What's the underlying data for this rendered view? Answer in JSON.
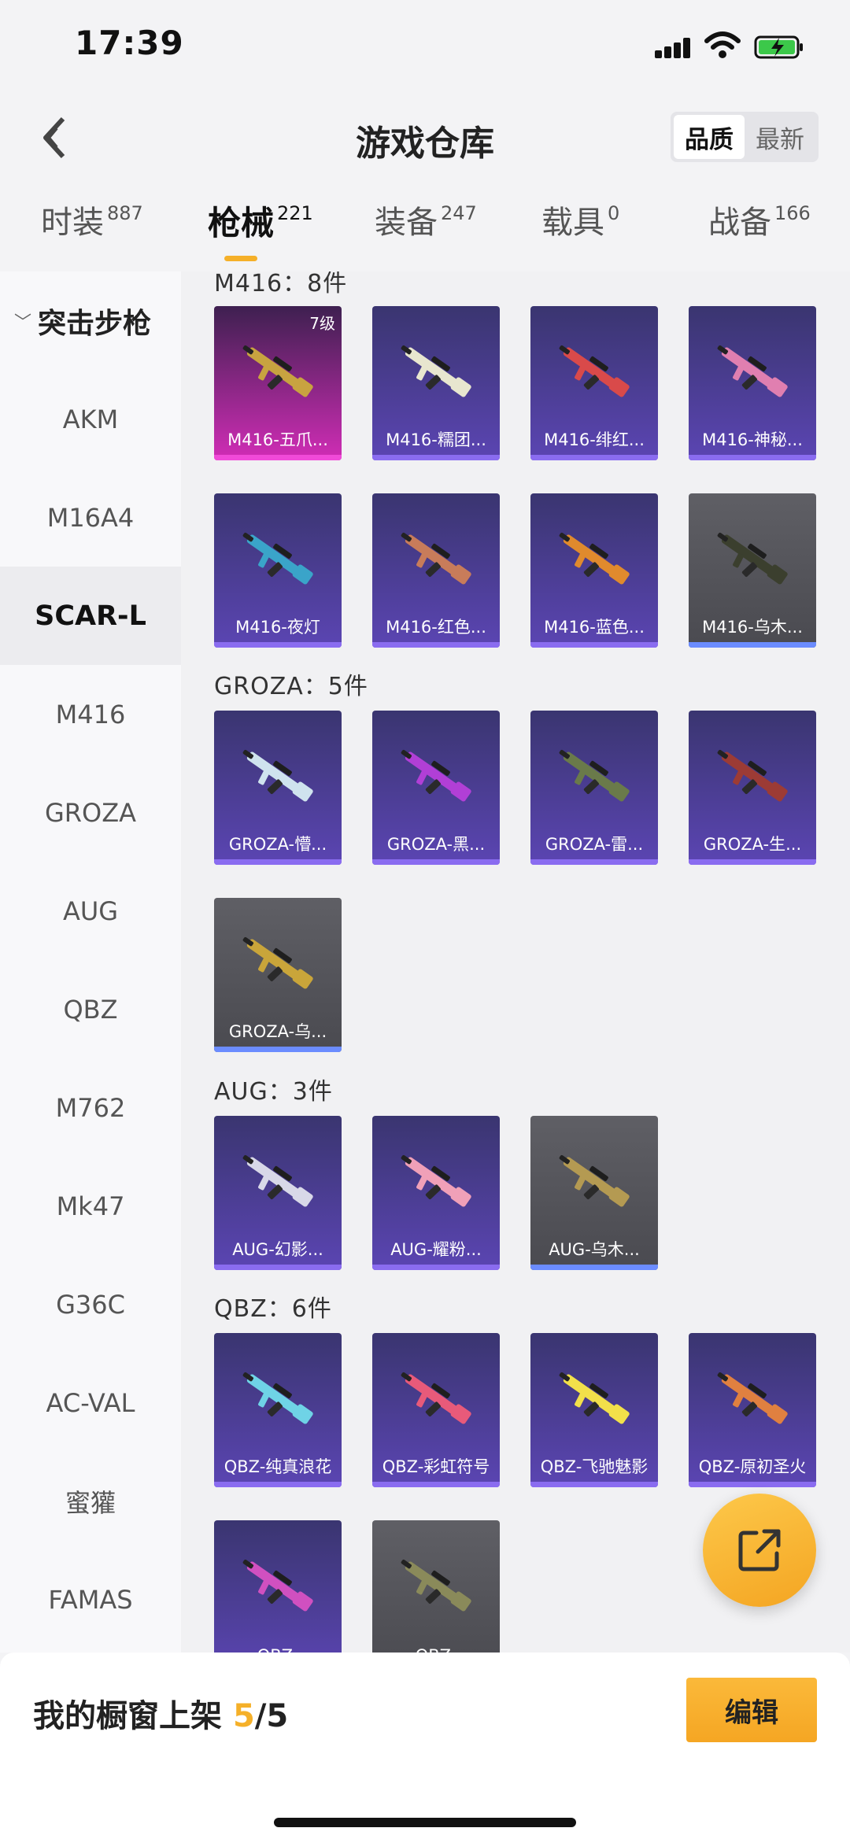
{
  "status": {
    "time": "17:39"
  },
  "header": {
    "title": "游戏仓库",
    "sort_options": [
      "品质",
      "最新"
    ]
  },
  "tabs": [
    {
      "label": "时装",
      "count": "887"
    },
    {
      "label": "枪械",
      "count": "221"
    },
    {
      "label": "装备",
      "count": "247"
    },
    {
      "label": "载具",
      "count": "0"
    },
    {
      "label": "战备",
      "count": "166"
    }
  ],
  "sidebar": {
    "group": "突击步枪",
    "items": [
      "AKM",
      "M16A4",
      "SCAR-L",
      "M416",
      "GROZA",
      "AUG",
      "QBZ",
      "M762",
      "Mk47",
      "G36C",
      "AC-VAL",
      "蜜獾",
      "FAMAS"
    ]
  },
  "sections": [
    {
      "title": "M416：8件",
      "items": [
        {
          "name": "M416-五爪...",
          "tier": "pink",
          "gun_color": "#c8a340",
          "level": "7级"
        },
        {
          "name": "M416-糯团...",
          "tier": "purple",
          "gun_color": "#e8e6cf"
        },
        {
          "name": "M416-绯红...",
          "tier": "purple",
          "gun_color": "#d94a4a"
        },
        {
          "name": "M416-神秘...",
          "tier": "purple",
          "gun_color": "#e07fb0"
        },
        {
          "name": "M416-夜灯",
          "tier": "purple",
          "gun_color": "#3aa4c9"
        },
        {
          "name": "M416-红色...",
          "tier": "purple",
          "gun_color": "#c87c5a"
        },
        {
          "name": "M416-蓝色...",
          "tier": "purple",
          "gun_color": "#e08a2d"
        },
        {
          "name": "M416-乌木...",
          "tier": "grey",
          "gun_color": "#3b3f2e"
        }
      ]
    },
    {
      "title": "GROZA：5件",
      "items": [
        {
          "name": "GROZA-懵...",
          "tier": "purple",
          "gun_color": "#cfe3ee"
        },
        {
          "name": "GROZA-黑...",
          "tier": "purple",
          "gun_color": "#b13fd6"
        },
        {
          "name": "GROZA-雷...",
          "tier": "purple",
          "gun_color": "#6a7a4a"
        },
        {
          "name": "GROZA-生...",
          "tier": "purple",
          "gun_color": "#9c3b35"
        },
        {
          "name": "GROZA-乌...",
          "tier": "grey",
          "gun_color": "#c9a53a"
        }
      ]
    },
    {
      "title": "AUG：3件",
      "items": [
        {
          "name": "AUG-幻影...",
          "tier": "purple",
          "gun_color": "#d8d8e8"
        },
        {
          "name": "AUG-耀粉...",
          "tier": "purple",
          "gun_color": "#f0a0b8"
        },
        {
          "name": "AUG-乌木...",
          "tier": "grey",
          "gun_color": "#b49a52"
        }
      ]
    },
    {
      "title": "QBZ：6件",
      "items": [
        {
          "name": "QBZ-纯真浪花",
          "tier": "purple",
          "gun_color": "#6fd3e6"
        },
        {
          "name": "QBZ-彩虹符号",
          "tier": "purple",
          "gun_color": "#e85a7a"
        },
        {
          "name": "QBZ-飞驰魅影",
          "tier": "purple",
          "gun_color": "#f2e04a"
        },
        {
          "name": "QBZ-原初圣火",
          "tier": "purple",
          "gun_color": "#e08040"
        },
        {
          "name": "QBZ-",
          "tier": "purple",
          "gun_color": "#d050c0"
        },
        {
          "name": "QBZ-",
          "tier": "grey",
          "gun_color": "#8a8a5a"
        }
      ]
    }
  ],
  "bottom": {
    "label": "我的橱窗上架",
    "current": "5",
    "total": "/5",
    "edit": "编辑"
  }
}
